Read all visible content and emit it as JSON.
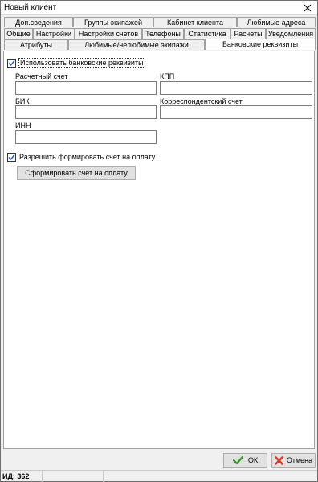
{
  "window": {
    "title": "Новый клиент"
  },
  "tabs": {
    "row1": [
      "Доп.сведения",
      "Группы экипажей",
      "Кабинет клиента",
      "Любимые адреса"
    ],
    "row2": [
      "Общие",
      "Настройки",
      "Настройки счетов",
      "Телефоны",
      "Статистика",
      "Расчеты",
      "Уведомления"
    ],
    "row3": [
      "Атрибуты",
      "Любимые/нелюбимые экипажи",
      "Банковские реквизиты"
    ],
    "active": "Банковские реквизиты"
  },
  "bank": {
    "use_bank_details_label": "Использовать банковские реквизиты",
    "use_bank_details_checked": true,
    "account_label": "Расчетный счет",
    "account_value": "",
    "kpp_label": "КПП",
    "kpp_value": "",
    "bik_label": "БИК",
    "bik_value": "",
    "corr_account_label": "Корреспондентский счет",
    "corr_account_value": "",
    "inn_label": "ИНН",
    "inn_value": "",
    "allow_invoice_label": "Разрешить формировать счет на оплату",
    "allow_invoice_checked": true,
    "make_invoice_button": "Сформировать счет на оплату"
  },
  "footer": {
    "ok_label": "ОК",
    "cancel_label": "Отмена"
  },
  "status": {
    "id_text": "ИД: 362"
  },
  "colors": {
    "check_blue": "#1e5aa8",
    "ok_green": "#3a9a2a",
    "cancel_red": "#d83a2a"
  }
}
